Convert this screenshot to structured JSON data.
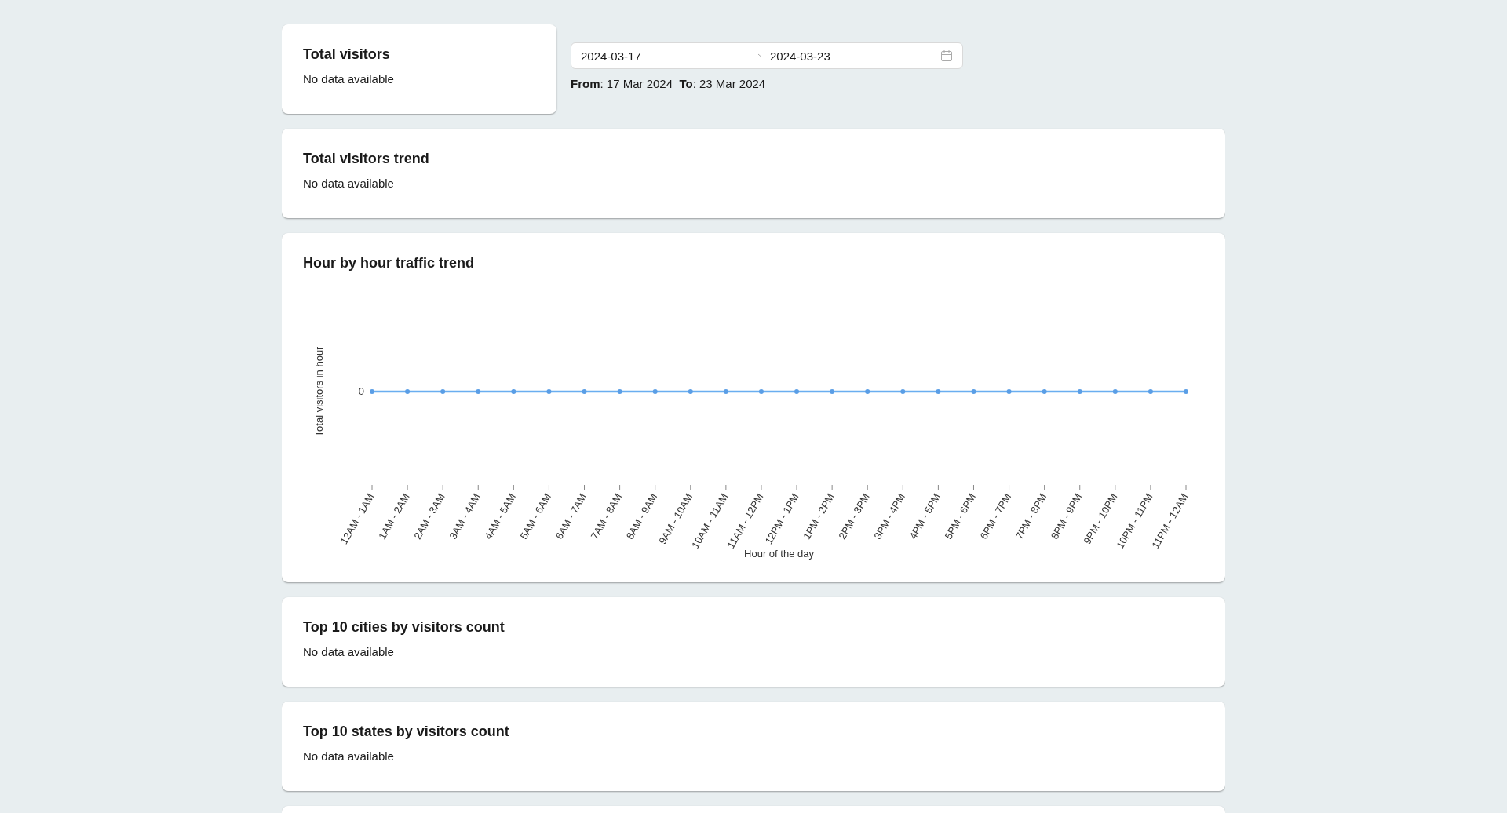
{
  "summary_card": {
    "title": "Total visitors",
    "message": "No data available"
  },
  "date_range": {
    "start": "2024-03-17",
    "end": "2024-03-23",
    "summary": "**From**: 17 Mar 2024  **To**: 23 Mar 2024"
  },
  "cards": [
    {
      "kind": "message",
      "title": "Total visitors trend",
      "message": "No data available"
    },
    {
      "kind": "chart",
      "title": "Hour by hour traffic trend",
      "chart": {
        "xlabel": "Hour of the day",
        "ylabel": "Total visitors in hour",
        "y_tick_label": "0",
        "x_tick_labels": [
          "12AM - 1AM",
          "1AM - 2AM",
          "2AM - 3AM",
          "3AM - 4AM",
          "4AM - 5AM",
          "5AM - 6AM",
          "6AM - 7AM",
          "7AM - 8AM",
          "8AM - 9AM",
          "9AM - 10AM",
          "10AM - 11AM",
          "11AM - 12PM",
          "12PM - 1PM",
          "1PM - 2PM",
          "2PM - 3PM",
          "3PM - 4PM",
          "4PM - 5PM",
          "5PM - 6PM",
          "6PM - 7PM",
          "7PM - 8PM",
          "8PM - 9PM",
          "9PM - 10PM",
          "10PM - 11PM",
          "11PM - 12AM"
        ]
      }
    },
    {
      "kind": "message",
      "title": "Top 10 cities by visitors count",
      "message": "No data available"
    },
    {
      "kind": "message",
      "title": "Top 10 states by visitors count",
      "message": "No data available"
    }
  ]
}
